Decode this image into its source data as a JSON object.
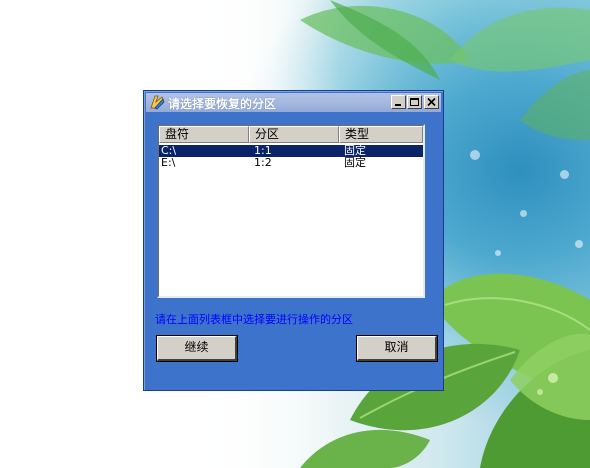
{
  "window": {
    "title": "请选择要恢复的分区",
    "controls": {
      "minimize": "minimize",
      "maximize": "maximize",
      "close": "close"
    }
  },
  "partition_list": {
    "columns": [
      "盘符",
      "分区",
      "类型"
    ],
    "rows": [
      {
        "drive": "C:\\",
        "partition": "1:1",
        "type": "固定",
        "selected": true
      },
      {
        "drive": "E:\\",
        "partition": "1:2",
        "type": "固定",
        "selected": false
      }
    ]
  },
  "hint_text": "请在上面列表框中选择要进行操作的分区",
  "buttons": {
    "continue": "继续",
    "cancel": "取消"
  },
  "colors": {
    "window_bg": "#3e73cc",
    "selection": "#0a246a",
    "hint": "#0000ff"
  },
  "icons": {
    "title": "app-icon"
  }
}
